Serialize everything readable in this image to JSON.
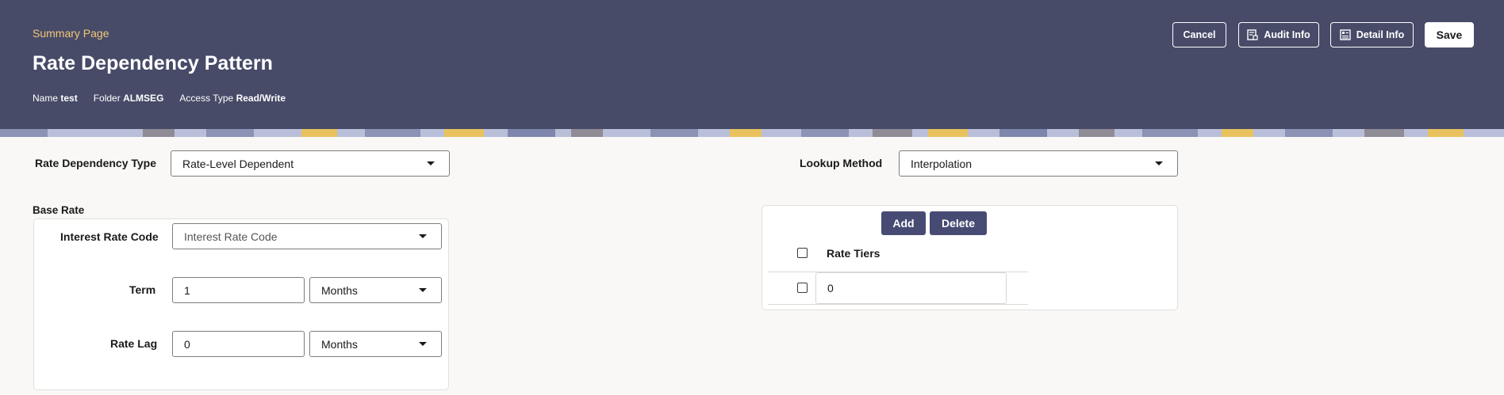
{
  "header": {
    "breadcrumb": "Summary Page",
    "title": "Rate Dependency Pattern",
    "meta": {
      "name_label": "Name",
      "name_value": "test",
      "folder_label": "Folder",
      "folder_value": "ALMSEG",
      "access_label": "Access Type",
      "access_value": "Read/Write"
    },
    "buttons": {
      "cancel": "Cancel",
      "audit": "Audit Info",
      "detail": "Detail Info",
      "save": "Save"
    },
    "accent_color": "#f3c677",
    "background_color": "#474b68"
  },
  "form": {
    "rate_dependency_type": {
      "label": "Rate Dependency Type",
      "value": "Rate-Level Dependent"
    },
    "lookup_method": {
      "label": "Lookup Method",
      "value": "Interpolation"
    }
  },
  "base_rate": {
    "title": "Base Rate",
    "interest_rate_code": {
      "label": "Interest Rate Code",
      "placeholder": "Interest Rate Code"
    },
    "term": {
      "label": "Term",
      "value": "1",
      "unit": "Months"
    },
    "rate_lag": {
      "label": "Rate Lag",
      "value": "0",
      "unit": "Months"
    }
  },
  "rate_tiers": {
    "add_label": "Add",
    "delete_label": "Delete",
    "column_header": "Rate Tiers",
    "rows": [
      {
        "value": "0"
      }
    ]
  },
  "icons": [
    "caret-down-icon",
    "audit-icon",
    "detail-icon",
    "checkbox-icon"
  ]
}
